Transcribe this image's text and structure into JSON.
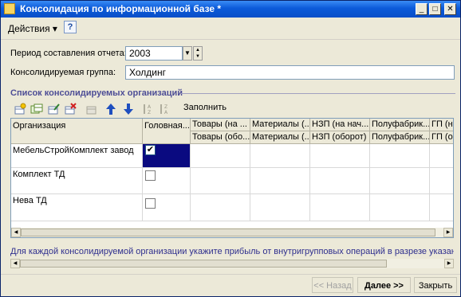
{
  "window": {
    "title": "Консолидация по информационной базе *",
    "minimize_label": "_",
    "maximize_label": "□",
    "close_label": "✕"
  },
  "toolbar": {
    "actions_label": "Действия",
    "actions_arrow": "▾",
    "help_label": "?"
  },
  "form": {
    "period_label": "Период составления отчета:",
    "period_value": "2003",
    "group_label": "Консолидируемая группа:",
    "group_value": "Холдинг"
  },
  "orgs_section": {
    "title": "Список консолидируемых организаций",
    "fill_label": "Заполнить"
  },
  "grid": {
    "org_header": "Организация",
    "head_header": "Головная...",
    "columns": [
      {
        "top": "Товары (на ...",
        "bottom": "Товары (обо..."
      },
      {
        "top": "Материалы (...",
        "bottom": "Материалы (..."
      },
      {
        "top": "НЗП (на нач...",
        "bottom": "НЗП (оборот)"
      },
      {
        "top": "Полуфабрик...",
        "bottom": "Полуфабрик..."
      },
      {
        "top": "ГП (на",
        "bottom": "ГП (о"
      }
    ],
    "rows": [
      {
        "org": "МебельСтройКомплект завод",
        "head": true
      },
      {
        "org": "Комплект ТД",
        "head": false
      },
      {
        "org": "Нева ТД",
        "head": false
      }
    ],
    "check_mark": "✔"
  },
  "note": "Для каждой консолидируемой организации укажите прибыль от внутригрупповых операций в разрезе указанных",
  "buttons": {
    "back": "<< Назад",
    "next": "Далее >>",
    "close": "Закрыть"
  },
  "colors": {
    "title_bar": "#0b5ad9",
    "selected_cell": "#0a0a80",
    "section_title": "#4d4d96",
    "note_text": "#2e2e8e"
  }
}
